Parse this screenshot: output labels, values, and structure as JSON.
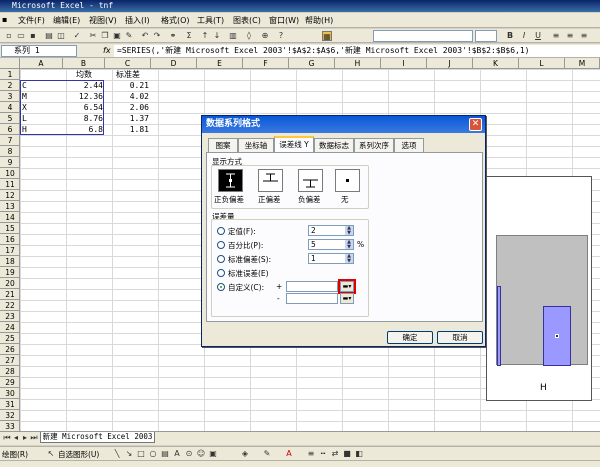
{
  "window": {
    "title": "Microsoft Excel - tnf",
    "icon": "excel-icon"
  },
  "menu": [
    "文件(F)",
    "编辑(E)",
    "视图(V)",
    "插入(I)",
    "格式(O)",
    "工具(T)",
    "图表(C)",
    "窗口(W)",
    "帮助(H)"
  ],
  "toolbar": {
    "bold": "B",
    "italic": "I",
    "underline": "U"
  },
  "formula_bar": {
    "name_box": "系列 1",
    "fx": "fx",
    "formula": "=SERIES(,'新建 Microsoft Excel 2003'!$A$2:$A$6,'新建 Microsoft Excel 2003'!$B$2:$B$6,1)"
  },
  "columns": [
    "A",
    "B",
    "C",
    "D",
    "E",
    "F",
    "G",
    "H",
    "I",
    "J",
    "K",
    "L",
    "M"
  ],
  "rows": [
    "1",
    "2",
    "3",
    "4",
    "5",
    "6",
    "7",
    "8",
    "9",
    "10",
    "11",
    "12",
    "13",
    "14",
    "15",
    "16",
    "17",
    "18",
    "19",
    "20",
    "21",
    "22",
    "23",
    "24",
    "25",
    "26",
    "27",
    "28",
    "29",
    "30",
    "31",
    "32",
    "33"
  ],
  "sheet": {
    "headers": [
      "",
      "均数",
      "标准差"
    ],
    "data": [
      [
        "C",
        "2.44",
        "0.21"
      ],
      [
        "M",
        "12.36",
        "4.02"
      ],
      [
        "X",
        "6.54",
        "2.06"
      ],
      [
        "L",
        "8.76",
        "1.37"
      ],
      [
        "H",
        "6.8",
        "1.81"
      ]
    ]
  },
  "chart": {
    "visible_category": "H",
    "bar_colors": {
      "fill": "#9999ff",
      "plot": "#c0c0c0"
    }
  },
  "dialog": {
    "title": "数据系列格式",
    "tabs": [
      "图案",
      "坐标轴",
      "误差线 Y",
      "数据标志",
      "系列次序",
      "选项"
    ],
    "active_tab": "误差线 Y",
    "display_section": "显示方式",
    "display_options": [
      "正负偏差",
      "正偏差",
      "负偏差",
      "无"
    ],
    "amount_section": "误差量",
    "fixed_label": "定值(F):",
    "fixed_value": "2",
    "percent_label": "百分比(P):",
    "percent_value": "5",
    "percent_unit": "%",
    "stddev_label": "标准偏差(S):",
    "stddev_value": "1",
    "stderr_label": "标准误差(E)",
    "custom_label": "自定义(C):",
    "plus_sign": "+",
    "minus_sign": "-",
    "ok": "确定",
    "cancel": "取消"
  },
  "sheet_tab": "新建 Microsoft Excel 2003",
  "draw_toolbar": {
    "draw": "绘图(R)",
    "autoshape": "自选图形(U)"
  }
}
